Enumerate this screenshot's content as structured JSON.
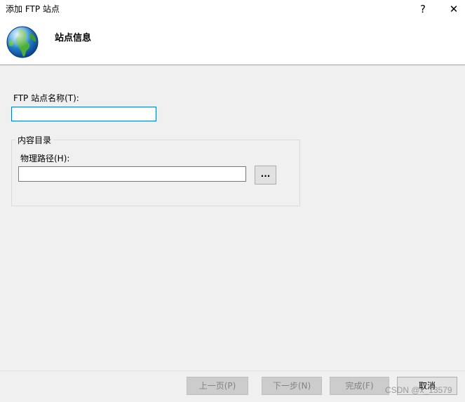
{
  "window": {
    "title": "添加 FTP 站点",
    "help_label": "?",
    "close_label": "✕"
  },
  "header": {
    "icon": "globe-icon",
    "page_title": "站点信息"
  },
  "form": {
    "site_name_label": "FTP 站点名称(T):",
    "site_name_value": "",
    "content_dir_group_label": "内容目录",
    "physical_path_label": "物理路径(H):",
    "physical_path_value": "",
    "browse_label": "..."
  },
  "footer": {
    "prev_label": "上一页(P)",
    "next_label": "下一步(N)",
    "finish_label": "完成(F)",
    "cancel_label": "取消",
    "watermark": "CSDN @x_13579"
  },
  "colors": {
    "accent_focus_border": "#0078d7",
    "dialog_background": "#f0f0f0",
    "header_background": "#ffffff",
    "disabled_text": "#838383"
  }
}
